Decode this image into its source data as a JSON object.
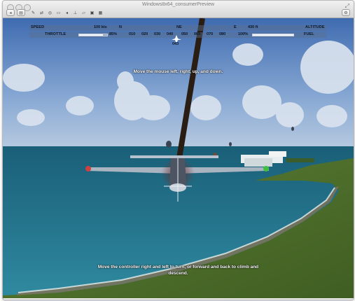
{
  "window": {
    "title": "Windows8x64_consumerPreview"
  },
  "toolbar": {
    "back_icon": "back-icon",
    "settings_icon": "settings-icon",
    "tools": [
      "wrench-icon",
      "network-icon",
      "cd-icon",
      "printer-icon",
      "sound-icon",
      "usb-icon",
      "folder-icon",
      "camera-icon",
      "display-icon"
    ],
    "fullscreen_icon": "fullscreen-icon"
  },
  "hud": {
    "speed_label": "SPEED",
    "speed_value": "100 kts",
    "throttle_label": "THROTTLE",
    "throttle_value": "85%",
    "throttle_level": 0.85,
    "altitude_label": "ALTITUDE",
    "altitude_value": "430 ft",
    "fuel_label": "FUEL",
    "fuel_value": "100%",
    "fuel_level": 1.0,
    "compass": {
      "letters": [
        "N",
        "NE",
        "E"
      ],
      "ticks": [
        "010",
        "020",
        "030",
        "040",
        "050",
        "060",
        "070",
        "080"
      ],
      "heading": "043"
    }
  },
  "instructions": {
    "top": "Move the mouse left, right, up, and down.",
    "bottom_line1": "Move the controller right and left to turn, or forward and back to climb and",
    "bottom_line2": "descend."
  },
  "colors": {
    "sky": "#6f93c4",
    "ocean": "#1e6f86",
    "land": "#4a6b2a",
    "hud_text": "#0c1626"
  }
}
